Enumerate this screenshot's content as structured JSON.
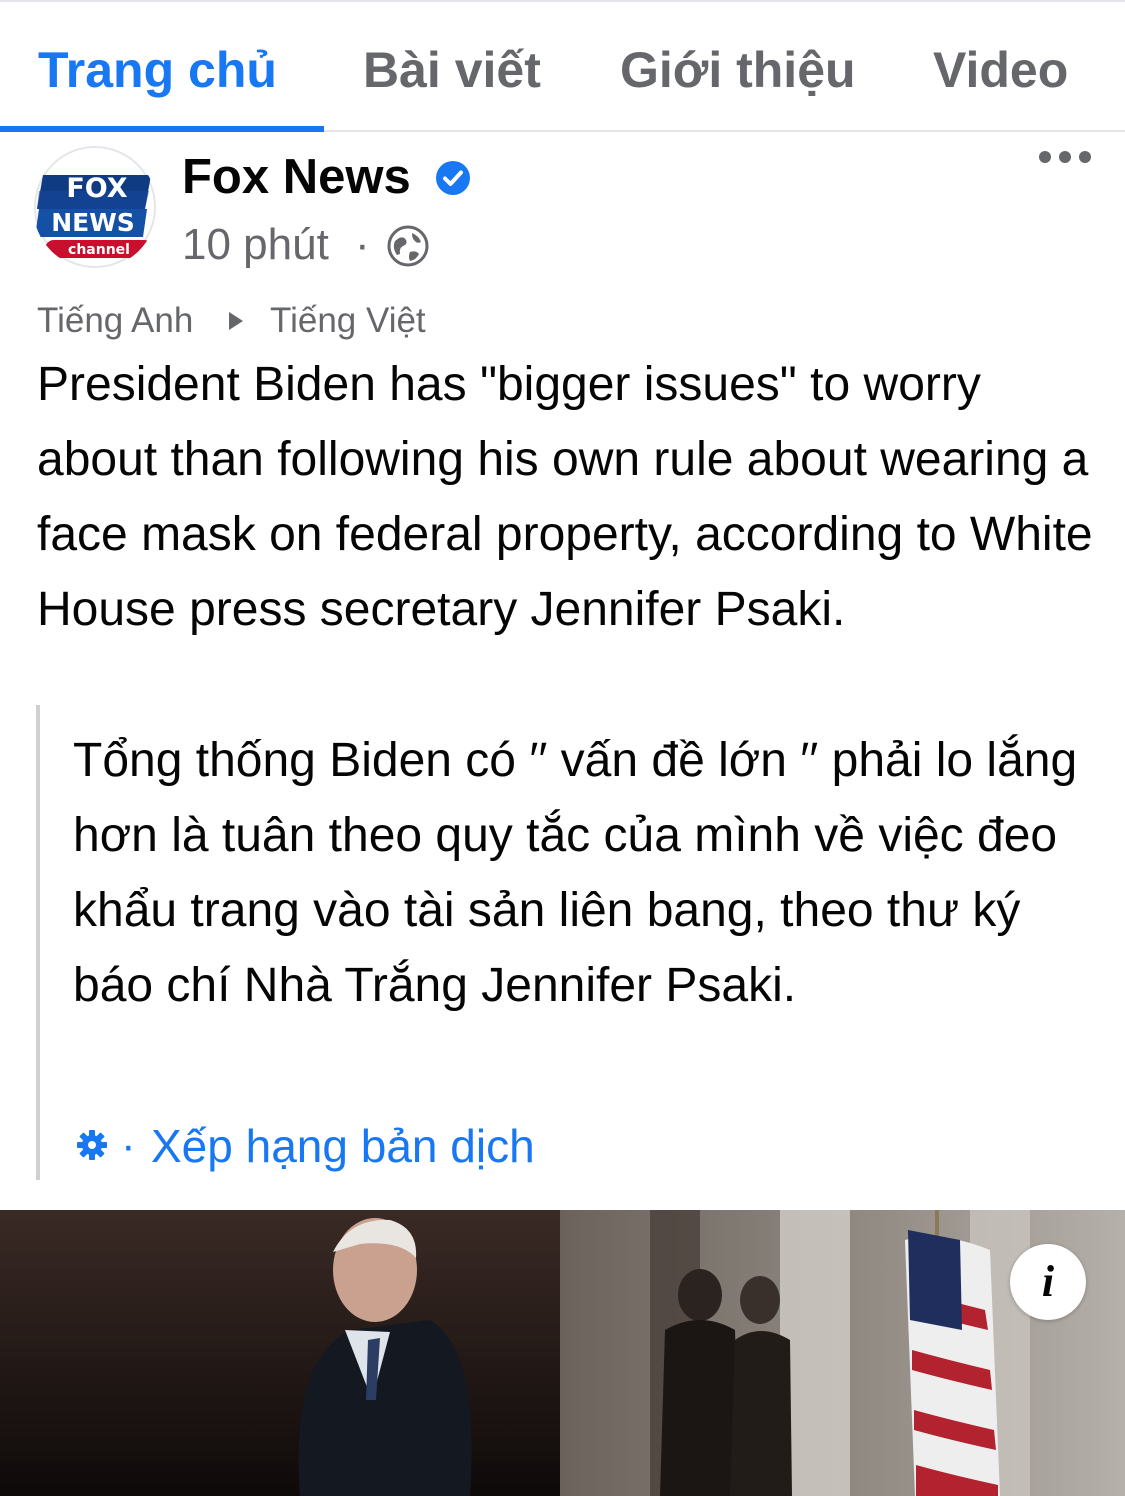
{
  "tabs": [
    {
      "label": "Trang chủ",
      "active": true
    },
    {
      "label": "Bài viết",
      "active": false
    },
    {
      "label": "Giới thiệu",
      "active": false
    },
    {
      "label": "Video",
      "active": false
    }
  ],
  "post": {
    "page_name": "Fox News",
    "avatar_logo": {
      "line1": "FOX",
      "line2": "NEWS",
      "line3": "channel"
    },
    "verified": true,
    "time": "10 phút",
    "audience_icon": "globe-icon",
    "more_icon": "more-dots-icon",
    "translation": {
      "from": "Tiếng Anh",
      "to": "Tiếng Việt",
      "rate_label": "Xếp hạng bản dịch"
    },
    "text": "President Biden has \"bigger issues\" to worry about than following his own rule about wearing a face mask on federal property, according to White House press secretary Jennifer Psaki.",
    "translated_text": "Tổng thống Biden có ′′ vấn đề lớn ′′ phải lo lắng hơn là tuân theo quy tắc của mình về việc đeo khẩu trang vào tài sản liên bang, theo thư ký báo chí Nhà Trắng Jennifer Psaki.",
    "photo_info_icon": "info-icon"
  },
  "colors": {
    "accent": "#1877f2",
    "secondary_text": "#65676b",
    "divider": "#e4e6eb"
  }
}
